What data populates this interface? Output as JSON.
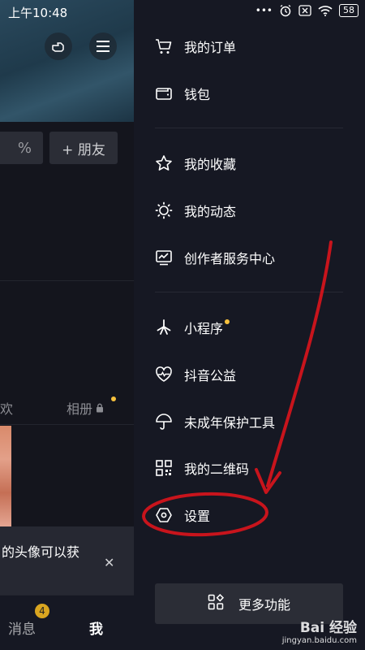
{
  "status_bar": {
    "time": "上午10:48",
    "battery": "58"
  },
  "left_page": {
    "percent": "%",
    "add_friend": "+ 朋友",
    "tab_likes_fragment": "欢",
    "tab_album": "相册",
    "toast_text": "的头像可以获",
    "nav_messages": "消息",
    "nav_messages_badge": "4",
    "nav_me": "我"
  },
  "drawer": {
    "items": [
      {
        "label": "我的订单",
        "icon": "cart-icon"
      },
      {
        "label": "钱包",
        "icon": "wallet-icon"
      },
      {
        "label": "我的收藏",
        "icon": "star-icon"
      },
      {
        "label": "我的动态",
        "icon": "sun-icon"
      },
      {
        "label": "创作者服务中心",
        "icon": "chart-monitor-icon"
      },
      {
        "label": "小程序",
        "icon": "miniprogram-icon"
      },
      {
        "label": "抖音公益",
        "icon": "heart-pulse-icon"
      },
      {
        "label": "未成年保护工具",
        "icon": "umbrella-icon"
      },
      {
        "label": "我的二维码",
        "icon": "qrcode-icon"
      },
      {
        "label": "设置",
        "icon": "hexagon-gear-icon"
      }
    ],
    "more_features": "更多功能"
  },
  "annotation": {
    "color": "#c8141c"
  },
  "watermark": {
    "main": "Bai 经验",
    "sub": "jingyan.baidu.com"
  }
}
